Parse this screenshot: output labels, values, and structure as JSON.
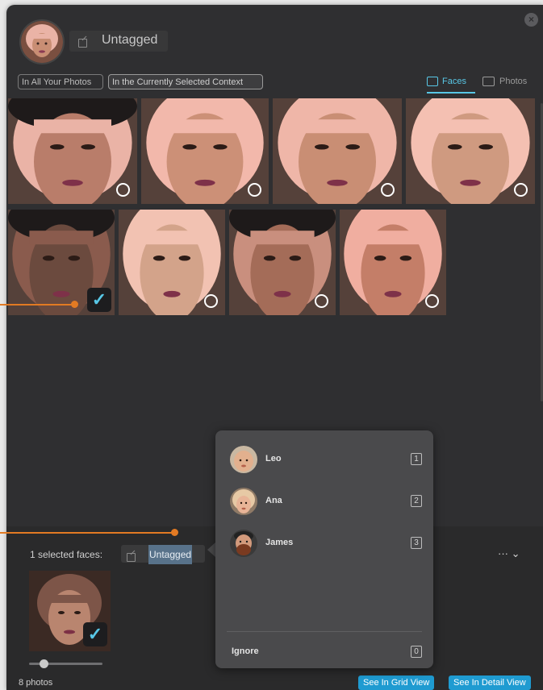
{
  "header": {
    "title": "Untagged",
    "close_glyph": "×"
  },
  "scope": {
    "all_photos": "In All Your Photos",
    "current_context": "In the Currently Selected Context"
  },
  "view_tabs": {
    "faces": "Faces",
    "photos": "Photos",
    "active": "Faces"
  },
  "grid": {
    "row1": [
      {
        "selected": false,
        "tone": "#b97d6a",
        "hair": "#eab3a6",
        "hat": true
      },
      {
        "selected": false,
        "tone": "#cc9077",
        "hair": "#f2b8ab",
        "hat": false
      },
      {
        "selected": false,
        "tone": "#c98e74",
        "hair": "#efb6a8",
        "hat": false
      },
      {
        "selected": false,
        "tone": "#cf9a80",
        "hair": "#f4c0b2",
        "hat": false
      }
    ],
    "row2": [
      {
        "selected": true,
        "tone": "#6b4a3e",
        "hair": "#8a5b4d",
        "hat": true
      },
      {
        "selected": false,
        "tone": "#d3a38a",
        "hair": "#f2c2b2",
        "hat": false
      },
      {
        "selected": false,
        "tone": "#a46c58",
        "hair": "#c98f7e",
        "hat": true
      },
      {
        "selected": false,
        "tone": "#c47e68",
        "hair": "#f0aea0",
        "hat": false
      }
    ],
    "check_glyph": "✓"
  },
  "bottom": {
    "selected_label": "1 selected faces:",
    "tag_value": "Untagged",
    "more_label": "··· ⌄",
    "photos_count": "8 photos",
    "slider_value": 0.2,
    "grid_view_button": "See In Grid View",
    "detail_view_button": "See In Detail View"
  },
  "popover": {
    "people": [
      {
        "name": "Leo",
        "key": "1",
        "icon": "baby-avatar"
      },
      {
        "name": "Ana",
        "key": "2",
        "icon": "woman-avatar"
      },
      {
        "name": "James",
        "key": "3",
        "icon": "bearded-man-avatar"
      }
    ],
    "ignore_label": "Ignore",
    "ignore_key": "0"
  },
  "colors": {
    "accent": "#58c7e6",
    "callout": "#e27a23",
    "button_blue": "#1f9bd1",
    "panel_bg": "#2f2f31"
  }
}
